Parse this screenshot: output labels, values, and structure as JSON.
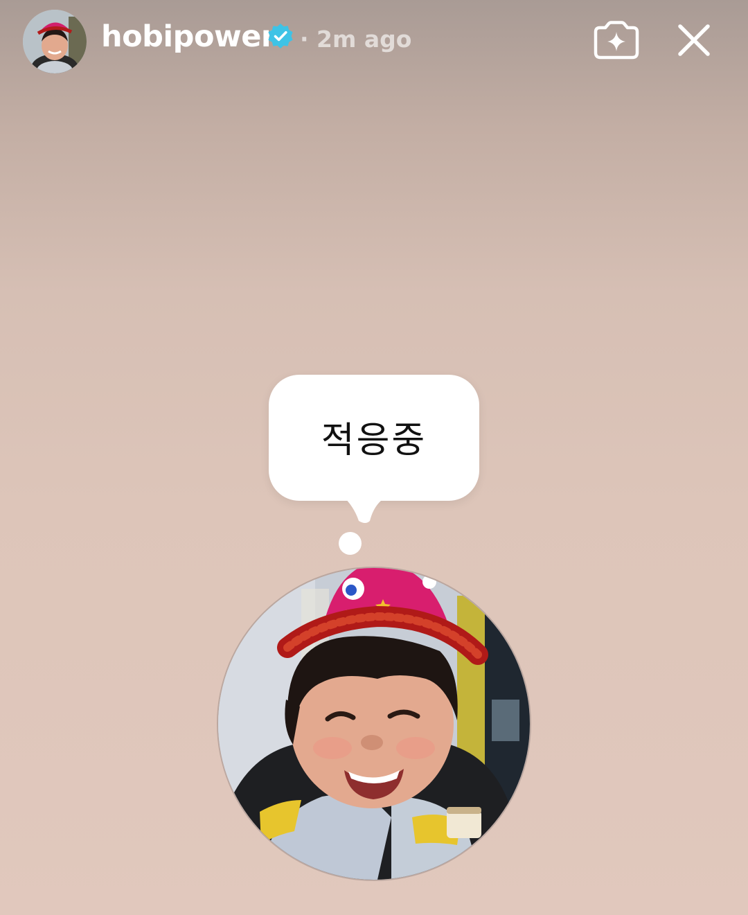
{
  "story": {
    "username": "hobipower",
    "verified": true,
    "timestamp": "· 2m ago",
    "note_text": "적응중"
  },
  "icons": {
    "verified": "verified-badge-icon",
    "sparkle": "sparkle-icon",
    "close": "close-icon"
  },
  "colors": {
    "verified_badge": "#3ec3e6",
    "text_primary": "#ffffff",
    "bubble": "#ffffff"
  }
}
